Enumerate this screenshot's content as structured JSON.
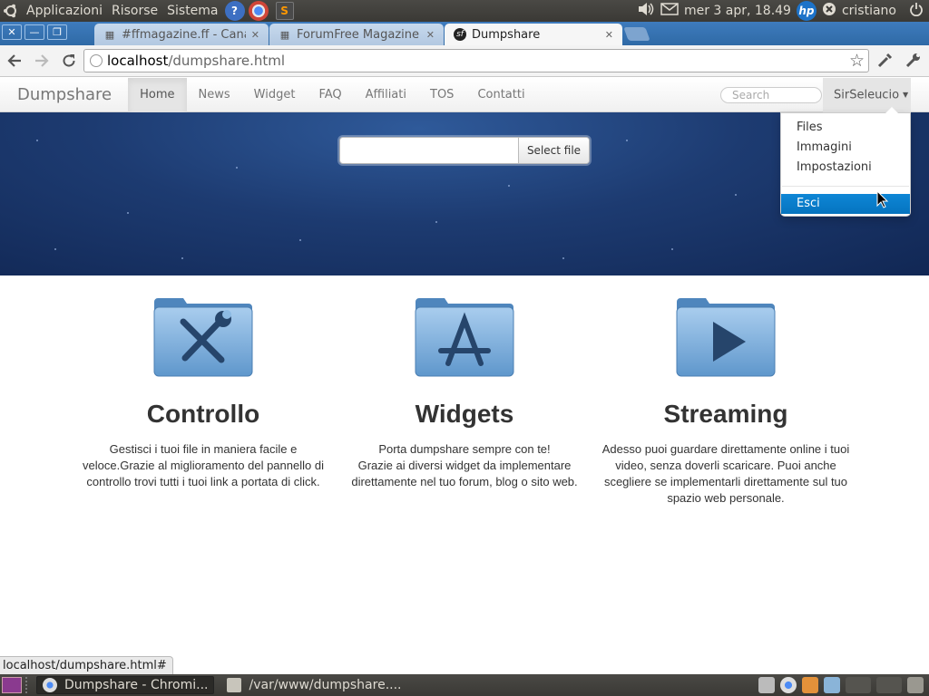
{
  "os_panel": {
    "menus": [
      "Applicazioni",
      "Risorse",
      "Sistema"
    ],
    "volume_icon": "speaker-icon",
    "clock": "mer  3 apr, 18.49",
    "user": "cristiano"
  },
  "browser": {
    "tabs": [
      {
        "title": "#ffmagazine.ff - Canale",
        "favicon": "page-icon"
      },
      {
        "title": "ForumFree Magazine - S",
        "favicon": "page-icon"
      },
      {
        "title": "Dumpshare",
        "favicon": "symfony-icon"
      }
    ],
    "url_host": "localhost",
    "url_path": "/dumpshare.html",
    "status_url": "localhost/dumpshare.html#"
  },
  "site": {
    "brand": "Dumpshare",
    "nav": [
      "Home",
      "News",
      "Widget",
      "FAQ",
      "Affiliati",
      "TOS",
      "Contatti"
    ],
    "active_nav": "Home",
    "search_placeholder": "Search",
    "user_menu": "SirSeleucio",
    "dropdown": {
      "items": [
        "Files",
        "Immagini",
        "Impostazioni"
      ],
      "logout": "Esci"
    },
    "upload_button": "Select file",
    "features": [
      {
        "title": "Controllo",
        "icon": "tools-folder-icon",
        "lines": [
          "Gestisci i tuoi file in maniera facile e",
          "veloce.Grazie al miglioramento del pannello di",
          "controllo trovi tutti i tuoi link a portata di click."
        ]
      },
      {
        "title": "Widgets",
        "icon": "apps-folder-icon",
        "lines": [
          "Porta dumpshare sempre con te!",
          "Grazie ai diversi widget da implementare",
          "direttamente nel tuo forum, blog o sito web."
        ]
      },
      {
        "title": "Streaming",
        "icon": "video-folder-icon",
        "lines": [
          "Adesso puoi guardare direttamente online i tuoi",
          "video, senza doverli scaricare. Puoi anche",
          "scegliere se implementarli direttamente sul tuo",
          "spazio web personale."
        ]
      }
    ]
  },
  "taskbar": {
    "tasks": [
      "Dumpshare - Chromi...",
      "/var/www/dumpshare...."
    ]
  },
  "colors": {
    "hero_bg": "#1d3b71",
    "dropdown_active": "#0c7fcf",
    "folder": "#7fb0dd"
  }
}
